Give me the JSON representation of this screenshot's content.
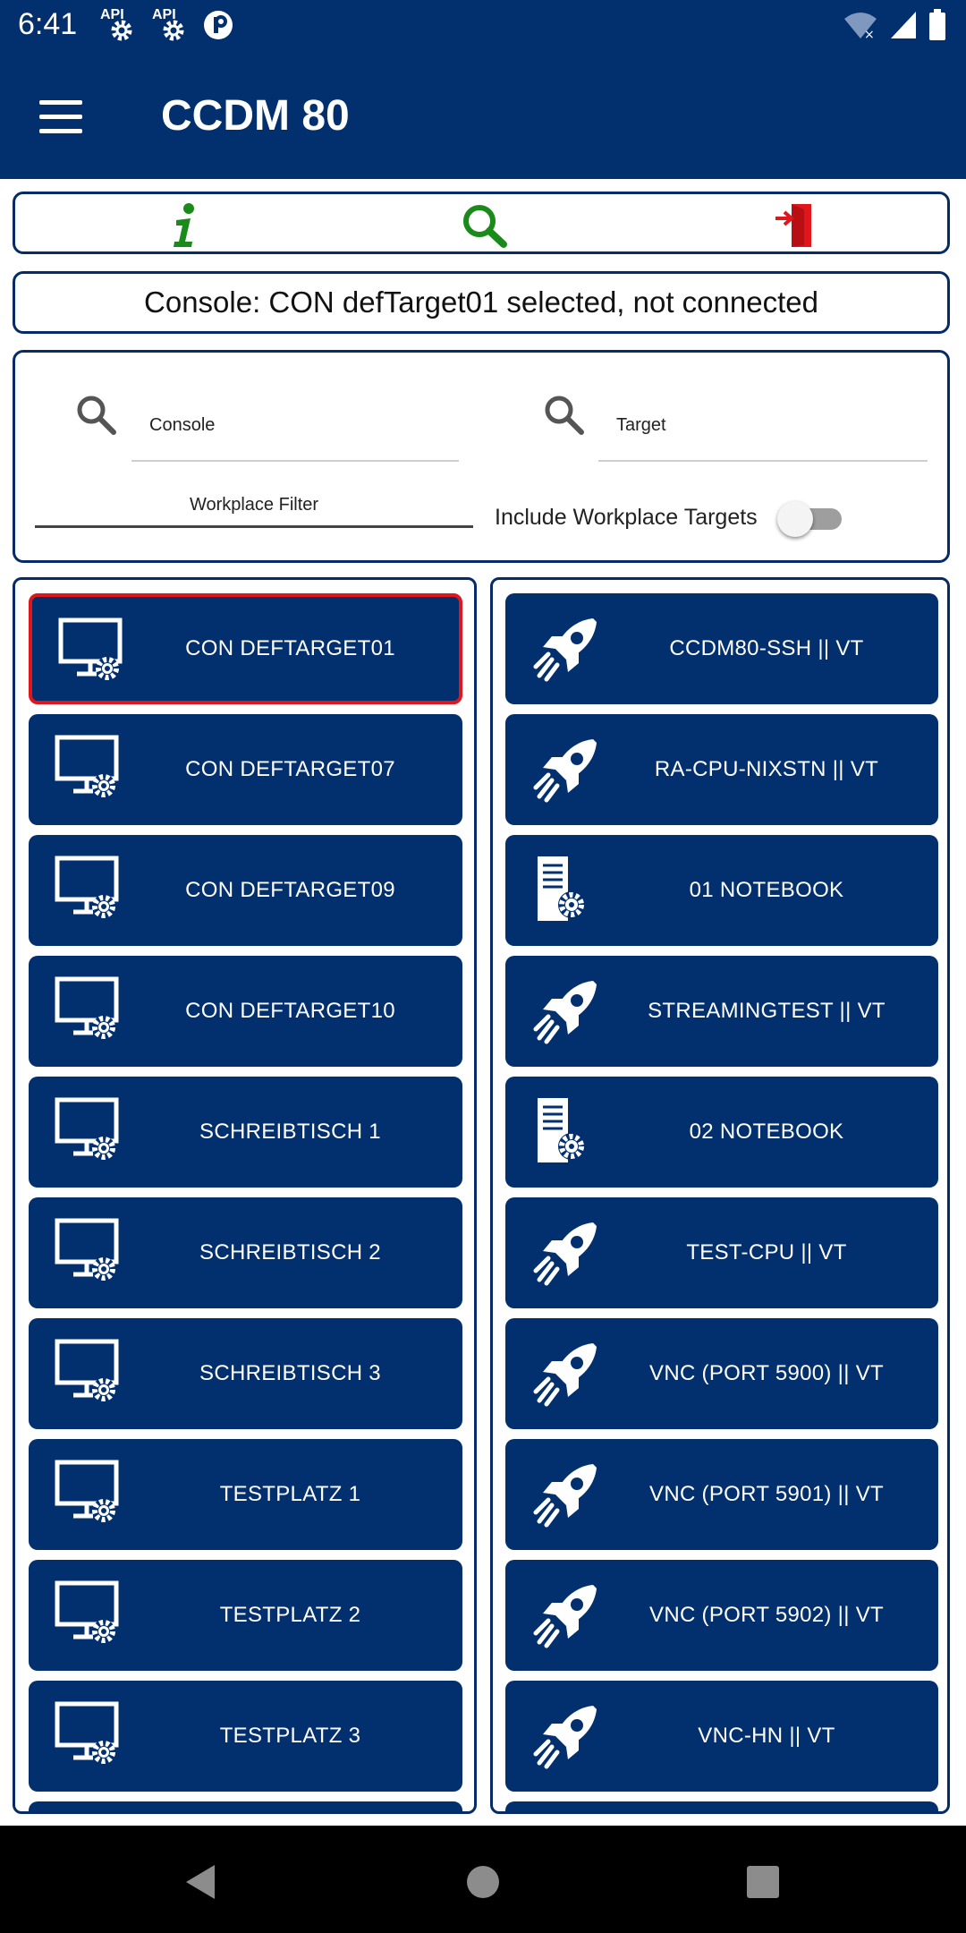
{
  "status_bar": {
    "time": "6:41",
    "api_label_1": "API",
    "api_label_2": "API",
    "icons": [
      "api-gear-icon",
      "api-gear-icon",
      "notification-app-icon",
      "wifi-icon",
      "signal-icon",
      "battery-icon"
    ]
  },
  "app_bar": {
    "title": "CCDM 80",
    "menu_icon": "hamburger-menu-icon"
  },
  "toolbar": {
    "info_icon": "info-icon",
    "search_icon": "search-icon",
    "logout_icon": "exit-door-icon"
  },
  "status_message": "Console: CON defTarget01 selected, not connected",
  "filters": {
    "console_placeholder": "Console",
    "target_placeholder": "Target",
    "workplace_filter_placeholder": "Workplace Filter",
    "include_workplace_label": "Include Workplace Targets",
    "include_workplace_enabled": false
  },
  "consoles": [
    {
      "label": "CON DEFTARGET01",
      "icon": "monitor-gear-icon",
      "selected": true
    },
    {
      "label": "CON DEFTARGET07",
      "icon": "monitor-gear-icon",
      "selected": false
    },
    {
      "label": "CON DEFTARGET09",
      "icon": "monitor-gear-icon",
      "selected": false
    },
    {
      "label": "CON DEFTARGET10",
      "icon": "monitor-gear-icon",
      "selected": false
    },
    {
      "label": "SCHREIBTISCH 1",
      "icon": "monitor-gear-icon",
      "selected": false
    },
    {
      "label": "SCHREIBTISCH 2",
      "icon": "monitor-gear-icon",
      "selected": false
    },
    {
      "label": "SCHREIBTISCH 3",
      "icon": "monitor-gear-icon",
      "selected": false
    },
    {
      "label": "TESTPLATZ 1",
      "icon": "monitor-gear-icon",
      "selected": false
    },
    {
      "label": "TESTPLATZ 2",
      "icon": "monitor-gear-icon",
      "selected": false
    },
    {
      "label": "TESTPLATZ 3",
      "icon": "monitor-gear-icon",
      "selected": false
    }
  ],
  "targets": [
    {
      "label": "CCDM80-SSH || VT",
      "icon": "rocket-icon"
    },
    {
      "label": "RA-CPU-NIXSTN || VT",
      "icon": "rocket-icon"
    },
    {
      "label": "01 NOTEBOOK",
      "icon": "server-gear-icon"
    },
    {
      "label": "STREAMINGTEST || VT",
      "icon": "rocket-icon"
    },
    {
      "label": "02 NOTEBOOK",
      "icon": "server-gear-icon"
    },
    {
      "label": "TEST-CPU || VT",
      "icon": "rocket-icon"
    },
    {
      "label": "VNC (PORT 5900) || VT",
      "icon": "rocket-icon"
    },
    {
      "label": "VNC (PORT 5901) || VT",
      "icon": "rocket-icon"
    },
    {
      "label": "VNC (PORT 5902) || VT",
      "icon": "rocket-icon"
    },
    {
      "label": "VNC-HN || VT",
      "icon": "rocket-icon"
    }
  ],
  "nav_bar": {
    "back_icon": "back-triangle-icon",
    "home_icon": "home-circle-icon",
    "recents_icon": "recents-square-icon"
  },
  "colors": {
    "primary": "#02306e",
    "selected_border": "#e0161c",
    "info_green": "#1a8a1a",
    "exit_red": "#e0161c"
  }
}
